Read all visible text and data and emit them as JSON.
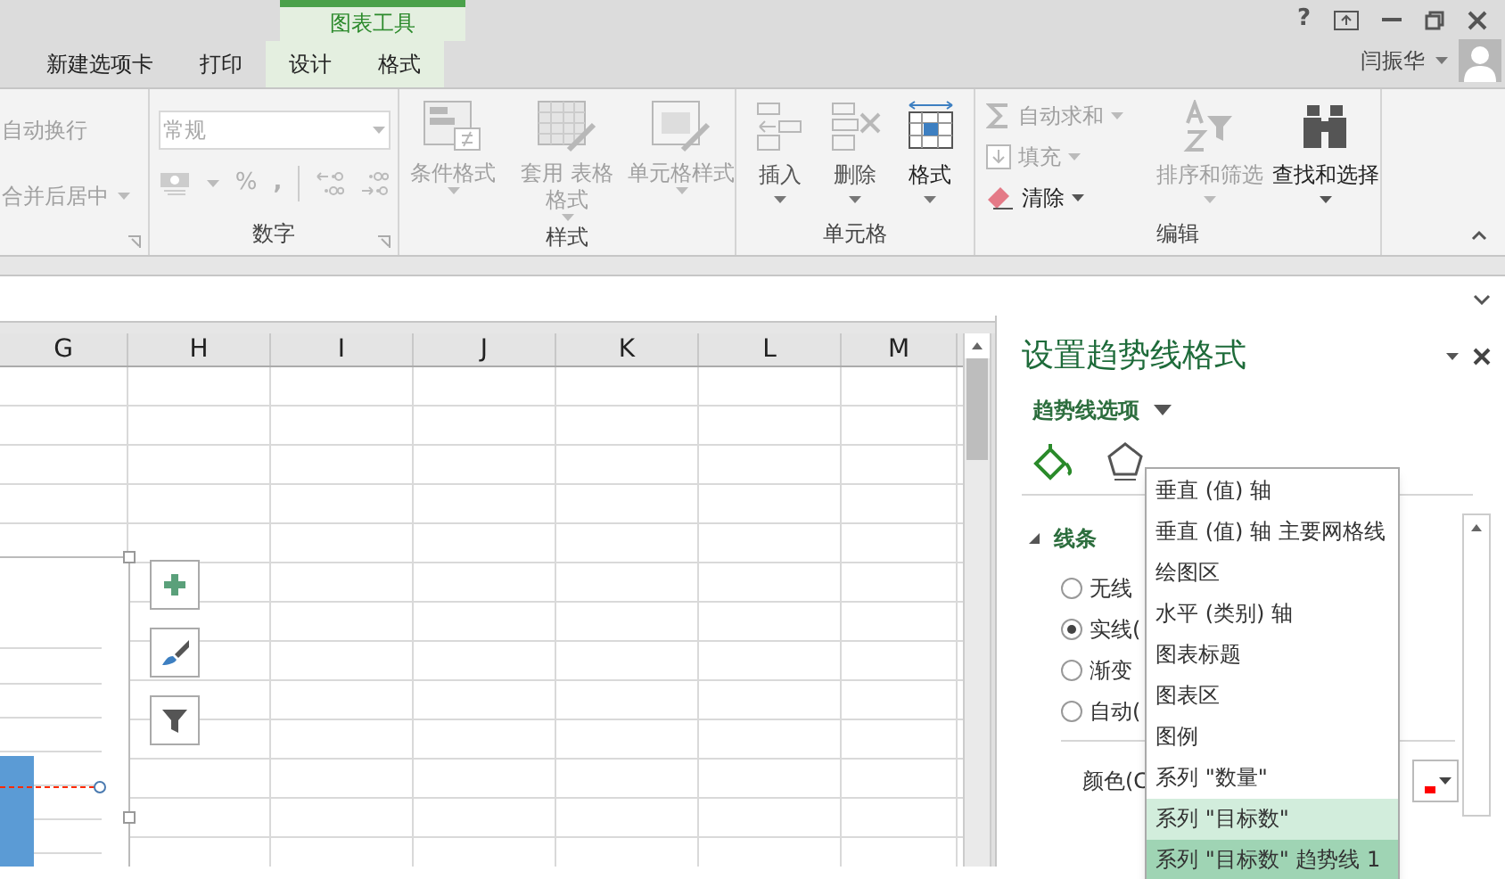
{
  "title_bar": {
    "contextual_group": "图表工具",
    "user": "闫振华",
    "help": "?",
    "tabs": [
      {
        "label": "新建选项卡",
        "contextual": false,
        "selected": false
      },
      {
        "label": "打印",
        "contextual": false,
        "selected": false
      },
      {
        "label": "设计",
        "contextual": true,
        "selected": false
      },
      {
        "label": "格式",
        "contextual": true,
        "selected": false
      }
    ]
  },
  "ribbon": {
    "alignment": {
      "items": [
        {
          "label": "自动换行",
          "disabled": true
        },
        {
          "label": "合并后居中",
          "disabled": true
        }
      ]
    },
    "number": {
      "label": "数字",
      "format": "常规",
      "percent": "%",
      "comma": ","
    },
    "styles": {
      "label": "样式",
      "items": [
        {
          "label": "条件格式",
          "kind": "conditional",
          "disabled": true
        },
        {
          "label": "套用 表格格式",
          "kind": "table",
          "disabled": true
        },
        {
          "label": "单元格样式",
          "kind": "cellstyle",
          "disabled": true
        }
      ]
    },
    "cells": {
      "label": "单元格",
      "items": [
        {
          "label": "插入",
          "kind": "insert",
          "disabled": true
        },
        {
          "label": "删除",
          "kind": "delete",
          "disabled": true
        },
        {
          "label": "格式",
          "kind": "format",
          "disabled": false
        }
      ]
    },
    "editing": {
      "label": "编辑",
      "small": [
        {
          "label": "自动求和",
          "kind": "sum",
          "disabled": true
        },
        {
          "label": "填充",
          "kind": "fill",
          "disabled": true
        },
        {
          "label": "清除",
          "kind": "clear",
          "disabled": false
        }
      ],
      "large": [
        {
          "label": "排序和筛选",
          "kind": "sort",
          "disabled": true
        },
        {
          "label": "查找和选择",
          "kind": "find",
          "disabled": false
        }
      ]
    }
  },
  "sheet": {
    "columns": [
      "G",
      "H",
      "I",
      "J",
      "K",
      "L",
      "M"
    ]
  },
  "format_pane": {
    "title": "设置趋势线格式",
    "options_label": "趋势线选项",
    "section": {
      "label": "线条",
      "expanded": true
    },
    "line_options": [
      {
        "label": "无线",
        "selected": false
      },
      {
        "label": "实线(",
        "selected": true
      },
      {
        "label": "渐变",
        "selected": false
      },
      {
        "label": "自动(",
        "selected": false
      }
    ],
    "color_label": "颜色(C",
    "color": "#ff0000"
  },
  "element_menu": [
    {
      "label": "垂直 (值) 轴",
      "selected": false,
      "hovered": false
    },
    {
      "label": "垂直 (值) 轴 主要网格线",
      "selected": false,
      "hovered": false
    },
    {
      "label": "绘图区",
      "selected": false,
      "hovered": false
    },
    {
      "label": "水平 (类别) 轴",
      "selected": false,
      "hovered": false
    },
    {
      "label": "图表标题",
      "selected": false,
      "hovered": false
    },
    {
      "label": "图表区",
      "selected": false,
      "hovered": false
    },
    {
      "label": "图例",
      "selected": false,
      "hovered": false
    },
    {
      "label": "系列 \"数量\"",
      "selected": false,
      "hovered": false
    },
    {
      "label": "系列 \"目标数\"",
      "selected": false,
      "hovered": true
    },
    {
      "label": "系列 \"目标数\" 趋势线 1",
      "selected": true,
      "hovered": false
    }
  ]
}
